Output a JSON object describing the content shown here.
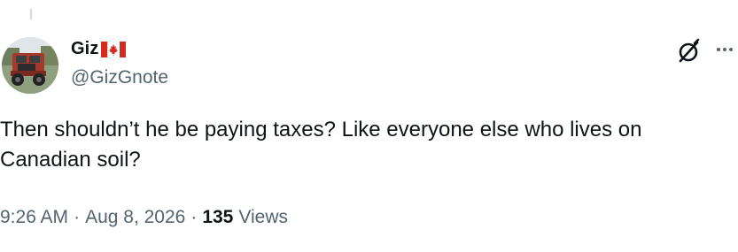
{
  "author": {
    "display_name": "Giz",
    "flag_icon": "canada-flag-icon",
    "handle": "@GizGnote",
    "avatar_icon": "truck-avatar"
  },
  "tweet": {
    "text": "Then shouldn’t he be paying taxes? Like everyone else who lives on Canadian soil?"
  },
  "meta": {
    "time": "9:26 AM",
    "separator": "·",
    "date": "Aug 8, 2026",
    "views_count": "135",
    "views_label": "Views"
  },
  "actions": {
    "grok_icon": "grok-icon",
    "more_icon": "more-options-icon"
  },
  "colors": {
    "text_primary": "#0f1419",
    "text_secondary": "#536471",
    "flag_red": "#d52b1e"
  }
}
